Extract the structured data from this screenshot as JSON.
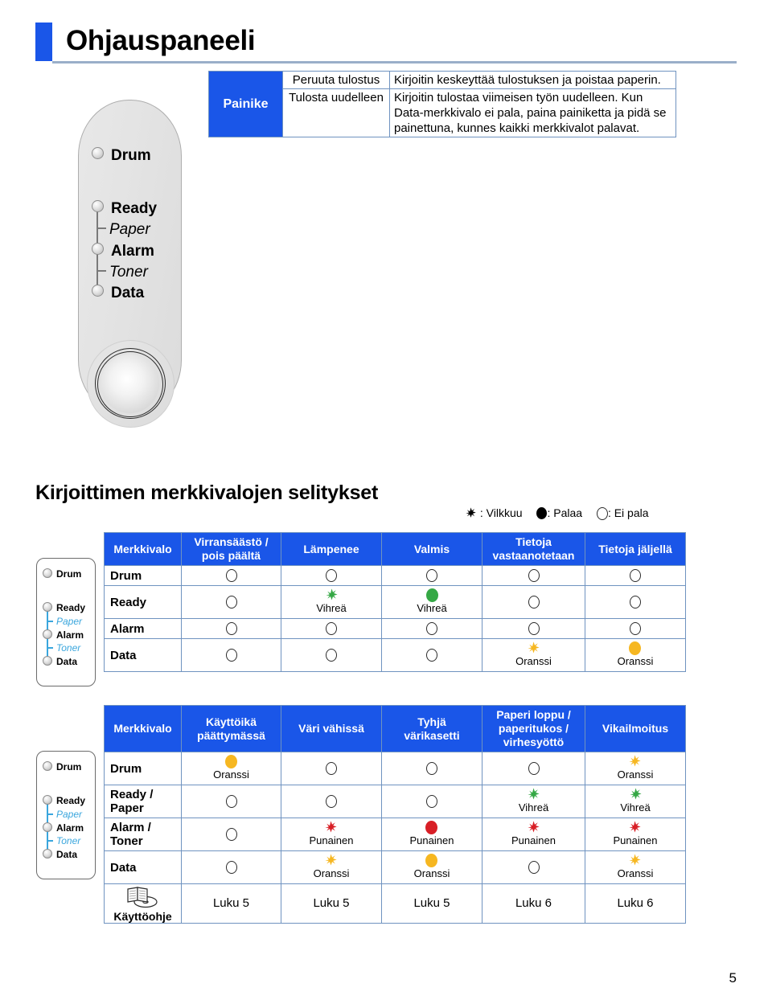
{
  "page": {
    "title": "Ohjauspaneeli",
    "page_number": "5",
    "accent_color": "#1a56e8",
    "rule_color": "#9aafc9"
  },
  "control_panel": {
    "leds": [
      {
        "name": "Drum",
        "style": "bold"
      },
      {
        "name": "Ready",
        "style": "bold"
      },
      {
        "name": "Paper",
        "style": "italic"
      },
      {
        "name": "Alarm",
        "style": "bold"
      },
      {
        "name": "Toner",
        "style": "italic"
      },
      {
        "name": "Data",
        "style": "bold"
      }
    ],
    "button_name": "panel-button"
  },
  "button_table": {
    "header_label": "Painike",
    "rows": [
      {
        "action": "Peruuta tulostus",
        "description": "Kirjoitin keskeyttää tulostuksen ja poistaa paperin."
      },
      {
        "action": "Tulosta uudelleen",
        "description": "Kirjoitin tulostaa viimeisen työn uudelleen. Kun Data-merkkivalo ei pala, paina painiketta ja pidä se painettuna, kunnes kaikki merkkivalot palavat."
      }
    ]
  },
  "section2": {
    "title": "Kirjoittimen merkkivalojen selitykset",
    "legend": [
      {
        "glyph": "blink",
        "label": ": Vilkkuu"
      },
      {
        "glyph": "on",
        "label": ": Palaa"
      },
      {
        "glyph": "off",
        "label": ": Ei pala"
      }
    ]
  },
  "status_table_1": {
    "headers": [
      "Merkkivalo",
      "Virransäästö /\npois päältä",
      "Lämpenee",
      "Valmis",
      "Tietoja\nvastaanotetaan",
      "Tietoja jäljellä"
    ],
    "rows": [
      {
        "label": "Drum",
        "cells": [
          {
            "state": "off",
            "caption": ""
          },
          {
            "state": "off",
            "caption": ""
          },
          {
            "state": "off",
            "caption": ""
          },
          {
            "state": "off",
            "caption": ""
          },
          {
            "state": "off",
            "caption": ""
          }
        ]
      },
      {
        "label": "Ready",
        "cells": [
          {
            "state": "off",
            "caption": ""
          },
          {
            "state": "blink",
            "color": "#35a845",
            "caption": "Vihreä"
          },
          {
            "state": "on",
            "color": "#35a845",
            "caption": "Vihreä"
          },
          {
            "state": "off",
            "caption": ""
          },
          {
            "state": "off",
            "caption": ""
          }
        ]
      },
      {
        "label": "Alarm",
        "cells": [
          {
            "state": "off",
            "caption": ""
          },
          {
            "state": "off",
            "caption": ""
          },
          {
            "state": "off",
            "caption": ""
          },
          {
            "state": "off",
            "caption": ""
          },
          {
            "state": "off",
            "caption": ""
          }
        ]
      },
      {
        "label": "Data",
        "cells": [
          {
            "state": "off",
            "caption": ""
          },
          {
            "state": "off",
            "caption": ""
          },
          {
            "state": "off",
            "caption": ""
          },
          {
            "state": "blink",
            "color": "#f6b721",
            "caption": "Oranssi"
          },
          {
            "state": "on",
            "color": "#f6b721",
            "caption": "Oranssi"
          }
        ]
      }
    ]
  },
  "status_table_2": {
    "headers": [
      "Merkkivalo",
      "Käyttöikä\npäättymässä",
      "Väri vähissä",
      "Tyhjä\nvärikasetti",
      "Paperi loppu /\npaperitukos /\nvirhesyöttö",
      "Vikailmoitus"
    ],
    "rows": [
      {
        "label": "Drum",
        "cells": [
          {
            "state": "on",
            "color": "#f6b721",
            "caption": "Oranssi"
          },
          {
            "state": "off",
            "caption": ""
          },
          {
            "state": "off",
            "caption": ""
          },
          {
            "state": "off",
            "caption": ""
          },
          {
            "state": "blink",
            "color": "#f6b721",
            "caption": "Oranssi"
          }
        ]
      },
      {
        "label": "Ready /\nPaper",
        "cells": [
          {
            "state": "off",
            "caption": ""
          },
          {
            "state": "off",
            "caption": ""
          },
          {
            "state": "off",
            "caption": ""
          },
          {
            "state": "blink",
            "color": "#35a845",
            "caption": "Vihreä"
          },
          {
            "state": "blink",
            "color": "#35a845",
            "caption": "Vihreä"
          }
        ]
      },
      {
        "label": "Alarm /\nToner",
        "cells": [
          {
            "state": "off",
            "caption": ""
          },
          {
            "state": "blink",
            "color": "#d81f26",
            "caption": "Punainen"
          },
          {
            "state": "on",
            "color": "#d81f26",
            "caption": "Punainen"
          },
          {
            "state": "blink",
            "color": "#d81f26",
            "caption": "Punainen"
          },
          {
            "state": "blink",
            "color": "#d81f26",
            "caption": "Punainen"
          }
        ]
      },
      {
        "label": "Data",
        "cells": [
          {
            "state": "off",
            "caption": ""
          },
          {
            "state": "blink",
            "color": "#f6b721",
            "caption": "Oranssi"
          },
          {
            "state": "on",
            "color": "#f6b721",
            "caption": "Oranssi"
          },
          {
            "state": "off",
            "caption": ""
          },
          {
            "state": "blink",
            "color": "#f6b721",
            "caption": "Oranssi"
          }
        ]
      }
    ],
    "manual_row": {
      "label": "Käyttöohje",
      "icon": "book-cd-icon",
      "values": [
        "Luku 5",
        "Luku 5",
        "Luku 5",
        "Luku 6",
        "Luku 6"
      ]
    }
  }
}
